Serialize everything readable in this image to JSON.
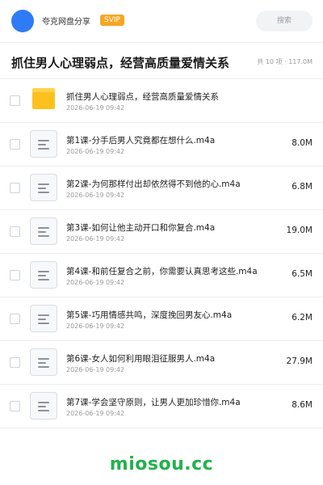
{
  "header": {
    "share_name": "夸克网盘分享",
    "badge": "SVIP",
    "search_placeholder": "搜索"
  },
  "folder": {
    "title": "抓住男人心理弱点，经营高质量爱情关系",
    "summary": "共 10 项 · 117.0M"
  },
  "items": [
    {
      "type": "folder",
      "name": "抓住男人心理弱点，经营高质量爱情关系",
      "date": "2026-06-19 09:42",
      "size": ""
    },
    {
      "type": "file",
      "name": "第1课-分手后男人究竟都在想什么.m4a",
      "date": "2026-06-19 09:42",
      "size": "8.0M"
    },
    {
      "type": "file",
      "name": "第2课-为何那样付出却依然得不到他的心.m4a",
      "date": "2026-06-19 09:42",
      "size": "6.8M"
    },
    {
      "type": "file",
      "name": "第3课-如何让他主动开口和你复合.m4a",
      "date": "2026-06-19 09:42",
      "size": "19.0M"
    },
    {
      "type": "file",
      "name": "第4课-和前任复合之前，你需要认真思考这些.m4a",
      "date": "2026-06-19 09:42",
      "size": "6.5M"
    },
    {
      "type": "file",
      "name": "第5课-巧用情感共鸣，深度挽回男友心.m4a",
      "date": "2026-06-19 09:42",
      "size": "6.2M"
    },
    {
      "type": "file",
      "name": "第6课-女人如何利用眼泪征服男人.m4a",
      "date": "2026-06-19 09:42",
      "size": "27.9M"
    },
    {
      "type": "file",
      "name": "第7课-学会坚守原则，让男人更加珍惜你.m4a",
      "date": "2026-06-19 09:42",
      "size": "8.6M"
    }
  ],
  "watermark": "miosou.cc",
  "colors": {
    "avatar": "#2f7bf5",
    "badge": "#f5a623",
    "folder": "#fcc11c",
    "watermark": "#23b14d"
  },
  "icons": {
    "folder": "folder-icon",
    "file": "audio-file-icon"
  }
}
